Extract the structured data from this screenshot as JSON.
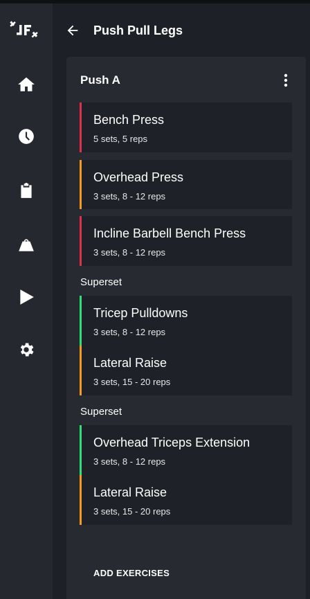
{
  "colors": {
    "background": "#1d2026",
    "rail": "#25282e",
    "card": "#272a31",
    "exercise_bg": "#1e2127",
    "chest": "#e0304d",
    "shoulders": "#f59a1f",
    "triceps": "#2ee07c"
  },
  "sidebar": {
    "logo_icon": "jf-logo-icon",
    "items": [
      {
        "icon": "home-icon"
      },
      {
        "icon": "history-clock-icon"
      },
      {
        "icon": "clipboard-icon"
      },
      {
        "icon": "kettlebell-icon"
      },
      {
        "icon": "play-icon"
      },
      {
        "icon": "gear-icon"
      }
    ]
  },
  "header": {
    "back_icon": "arrow-left-icon",
    "title": "Push Pull Legs"
  },
  "workout": {
    "title": "Push A",
    "menu_icon": "more-vertical-icon",
    "exercises": [
      {
        "name": "Bench Press",
        "detail": "5 sets, 5 reps",
        "color": "#e0304d"
      },
      {
        "name": "Overhead Press",
        "detail": "3 sets, 8 - 12 reps",
        "color": "#f59a1f"
      },
      {
        "name": "Incline Barbell Bench Press",
        "detail": "3 sets, 8 - 12 reps",
        "color": "#e0304d"
      }
    ],
    "supersets": [
      {
        "label": "Superset",
        "exercises": [
          {
            "name": "Tricep Pulldowns",
            "detail": "3 sets, 8 - 12 reps",
            "color": "#2ee07c"
          },
          {
            "name": "Lateral Raise",
            "detail": "3 sets, 15 - 20 reps",
            "color": "#f59a1f"
          }
        ]
      },
      {
        "label": "Superset",
        "exercises": [
          {
            "name": "Overhead Triceps Extension",
            "detail": "3 sets, 8 - 12 reps",
            "color": "#2ee07c"
          },
          {
            "name": "Lateral Raise",
            "detail": "3 sets, 15 - 20 reps",
            "color": "#f59a1f"
          }
        ]
      }
    ],
    "add_label": "ADD EXERCISES"
  }
}
